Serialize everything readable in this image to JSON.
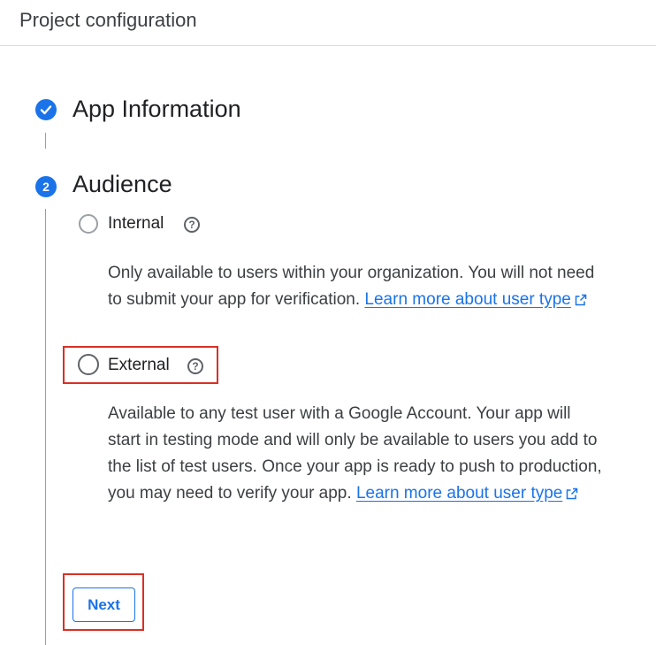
{
  "header": {
    "title": "Project configuration"
  },
  "steps": [
    {
      "number": "",
      "title": "App Information",
      "status": "completed"
    },
    {
      "number": "2",
      "title": "Audience",
      "status": "active"
    }
  ],
  "audience": {
    "options": [
      {
        "label": "Internal",
        "description": "Only available to users within your organization. You will not need to submit your app for verification.",
        "link_text": "Learn more about user type"
      },
      {
        "label": "External",
        "description": "Available to any test user with a Google Account. Your app will start in testing mode and will only be available to users you add to the list of test users. Once your app is ready to push to production, you may need to verify your app.",
        "link_text": "Learn more about user type"
      }
    ],
    "next_label": "Next"
  },
  "colors": {
    "accent": "#1a73e8",
    "highlight": "#d93025"
  }
}
